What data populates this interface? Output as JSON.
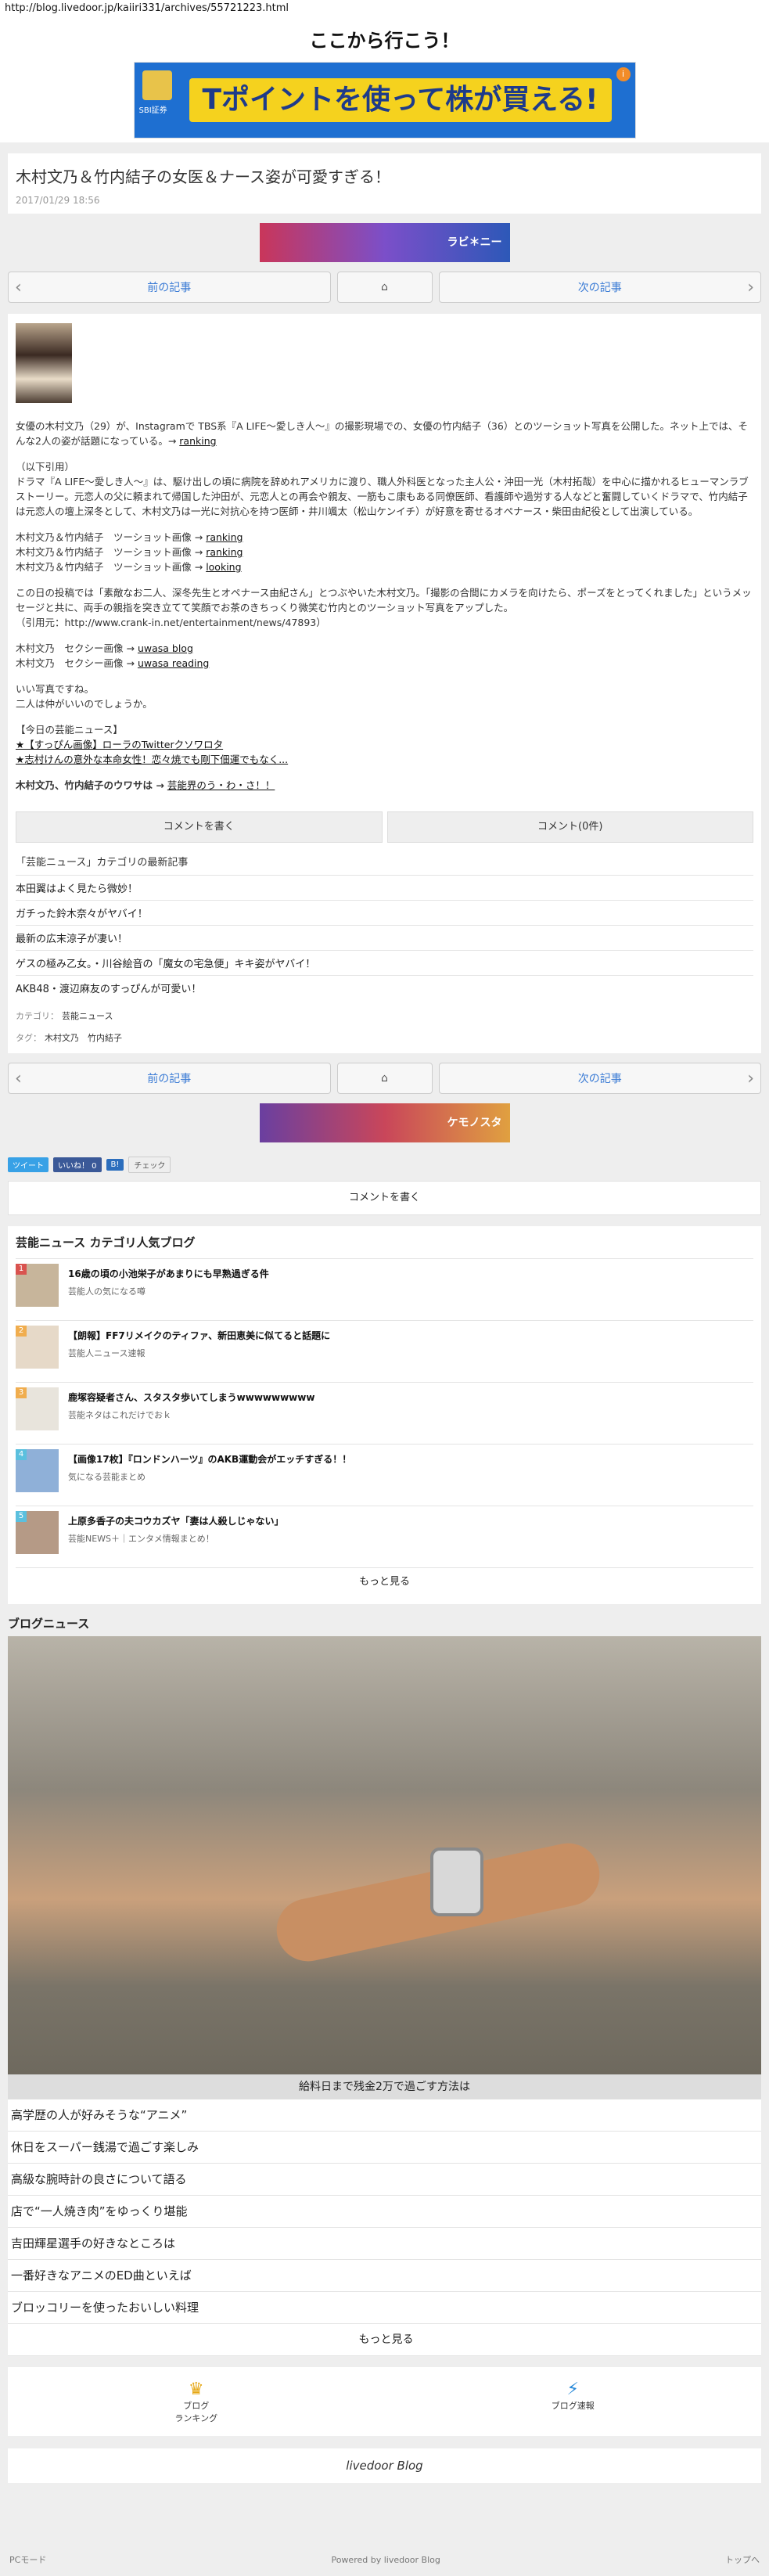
{
  "browser": {
    "url": "http://blog.livedoor.jp/kaiiri331/archives/55721223.html"
  },
  "header": {
    "site_title": "ここから行こう！",
    "banner_copy": "Tポイントを使って株が買える!",
    "banner_brand": "SBI証券",
    "banner_info": "i"
  },
  "article": {
    "title": "木村文乃＆竹内結子の女医＆ナース姿が可愛すぎる！",
    "date": "2017/01/29 18:56",
    "para1": "女優の木村文乃（29）が、Instagramで TBS系『A LIFE〜愛しき人〜』の撮影現場での、女優の竹内結子（36）とのツーショット写真を公開した。ネット上では、そんな2人の姿が話題になっている。→",
    "para1_link": "ranking",
    "quote_head": "（以下引用）",
    "quote": "ドラマ『A LIFE〜愛しき人〜』は、駆け出しの頃に病院を辞めれアメリカに渡り、職人外科医となった主人公・沖田一光（木村拓哉）を中心に描かれるヒューマンラブストーリー。元恋人の父に頼まれて帰国した沖田が、元恋人との再会や親友、一筋もこ康もある同僚医師、看護師や過労する人などと奮闘していくドラマで、竹内結子は元恋人の壇上深冬として、木村文乃は一光に対抗心を持つ医師・井川颯太（松山ケンイチ）が好意を寄せるオペナース・柴田由紀役として出演している。",
    "photo_lines": [
      {
        "label": "木村文乃＆竹内結子　ツーショット画像 →",
        "link": "ranking"
      },
      {
        "label": "木村文乃＆竹内結子　ツーショット画像 →",
        "link": "ranking"
      },
      {
        "label": "木村文乃＆竹内結子　ツーショット画像 →",
        "link": "looking"
      }
    ],
    "para2": "この日の投稿では「素敵なお二人、深冬先生とオペナース由紀さん」とつぶやいた木村文乃。「撮影の合間にカメラを向けたら、ポーズをとってくれました」というメッセージと共に、両手の親指を突き立てて笑顔でお茶のきちっくり微笑む竹内とのツーショット写真をアップした。",
    "source": "（引用元：http://www.crank-in.net/entertainment/news/47893）",
    "sexy_lines": [
      {
        "label": "木村文乃　セクシー画像 →",
        "link": "uwasa blog"
      },
      {
        "label": "木村文乃　セクシー画像 →",
        "link": "uwasa reading"
      }
    ],
    "comment1": "いい写真ですね。",
    "comment2": "二人は仲がいいのでしょうか。",
    "today_head": "【今日の芸能ニュース】",
    "today_items": [
      "★【すっぴん画像】ローラのTwitterクソワロタ",
      "★志村けんの意外な本命女性！恋々焼でも剛下佃運でもなく..."
    ],
    "rumor_prefix": "木村文乃、竹内結子のウワサは →",
    "rumor_link": "芸能界のう・わ・さ！！",
    "comment_write": "コメントを書く",
    "comment_count": "コメント(0件)",
    "category_head": "「芸能ニュース」カテゴリの最新記事",
    "category_items": [
      "本田翼はよく見たら微妙！",
      "ガチった鈴木奈々がヤバイ！",
      "最新の広末涼子が凄い！",
      "ゲスの極み乙女。・川谷絵音の「魔女の宅急便」キキ姿がヤバイ！",
      "AKB48・渡辺麻友のすっぴんが可愛い！"
    ],
    "category_label": "カテゴリ：",
    "category_value": "芸能ニュース",
    "tag_label": "タグ：",
    "tag_value": "木村文乃　竹内結子"
  },
  "pager": {
    "prev": "前の記事",
    "home_icon": "home-icon",
    "next": "次の記事"
  },
  "ad2_text": "ラビ＊ニー",
  "ad3_text": "ケモノスタ",
  "social": {
    "tweet": "ツイート",
    "like": "いいね！ 0",
    "hatena": "B!",
    "check": "チェック"
  },
  "comment_write2": "コメントを書く",
  "popular": {
    "heading": "芸能ニュース カテゴリ人気ブログ",
    "items": [
      {
        "rank": "1",
        "title": "16歳の頃の小池栄子があまりにも早熟過ぎる件",
        "blog": "芸能人の気になる噂",
        "color": "#d9534f"
      },
      {
        "rank": "2",
        "title": "【朗報】FF7リメイクのティファ、新田恵美に似てると話題に",
        "blog": "芸能人ニュース速報",
        "color": "#f0ad4e"
      },
      {
        "rank": "3",
        "title": "鹿塚容疑者さん、スタスタ歩いてしまうwwwwwwwww",
        "blog": "芸能ネタはこれだけでおｋ",
        "color": "#f0ad4e"
      },
      {
        "rank": "4",
        "title": "【画像17枚】『ロンドンハーツ』のAKB運動会がエッチすぎる！！",
        "blog": "気になる芸能まとめ",
        "color": "#5bc0de"
      },
      {
        "rank": "5",
        "title": "上原多香子の夫コウカズヤ「妻は人殺しじゃない」",
        "blog": "芸能NEWS＋｜エンタメ情報まとめ！",
        "color": "#5bc0de"
      }
    ],
    "more": "もっと見る"
  },
  "blog_news": {
    "heading": "ブログニュース",
    "caption": "給料日まで残金2万で過ごす方法は",
    "items": [
      "高学歴の人が好みそうな“アニメ”",
      "休日をスーパー銭湯で過ごす楽しみ",
      "高級な腕時計の良さについて語る",
      "店で“一人焼き肉”をゆっくり堪能",
      "吉田輝星選手の好きなところは",
      "一番好きなアニメのED曲といえば",
      "ブロッコリーを使ったおいしい料理"
    ],
    "more": "もっと見る"
  },
  "bottom_nav": {
    "ranking": "ブログ\nランキング",
    "news": "ブログ速報"
  },
  "brand": "livedoor Blog",
  "footer": {
    "pc_mode": "PCモード",
    "powered": "Powered by livedoor Blog",
    "top": "トップへ"
  }
}
